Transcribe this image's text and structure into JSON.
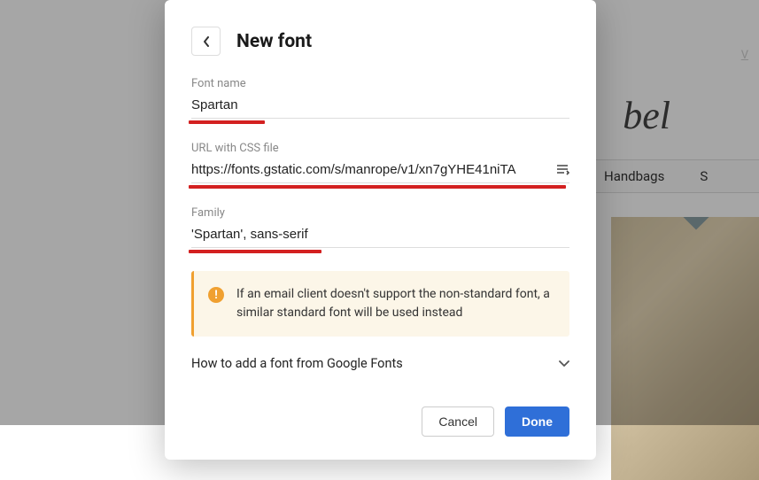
{
  "background": {
    "header_link": "V",
    "logo_fragment": "bel",
    "nav": {
      "handbags": "Handbags",
      "next": "S"
    }
  },
  "modal": {
    "title": "New font",
    "fields": {
      "font_name": {
        "label": "Font name",
        "value": "Spartan"
      },
      "url": {
        "label": "URL with CSS file",
        "value": "https://fonts.gstatic.com/s/manrope/v1/xn7gYHE41niTA"
      },
      "family": {
        "label": "Family",
        "value": "'Spartan', sans-serif"
      }
    },
    "notice": "If an email client doesn't support the non-standard font, a similar standard font will be used instead",
    "expander": "How to add a font from Google Fonts",
    "actions": {
      "cancel": "Cancel",
      "done": "Done"
    }
  }
}
